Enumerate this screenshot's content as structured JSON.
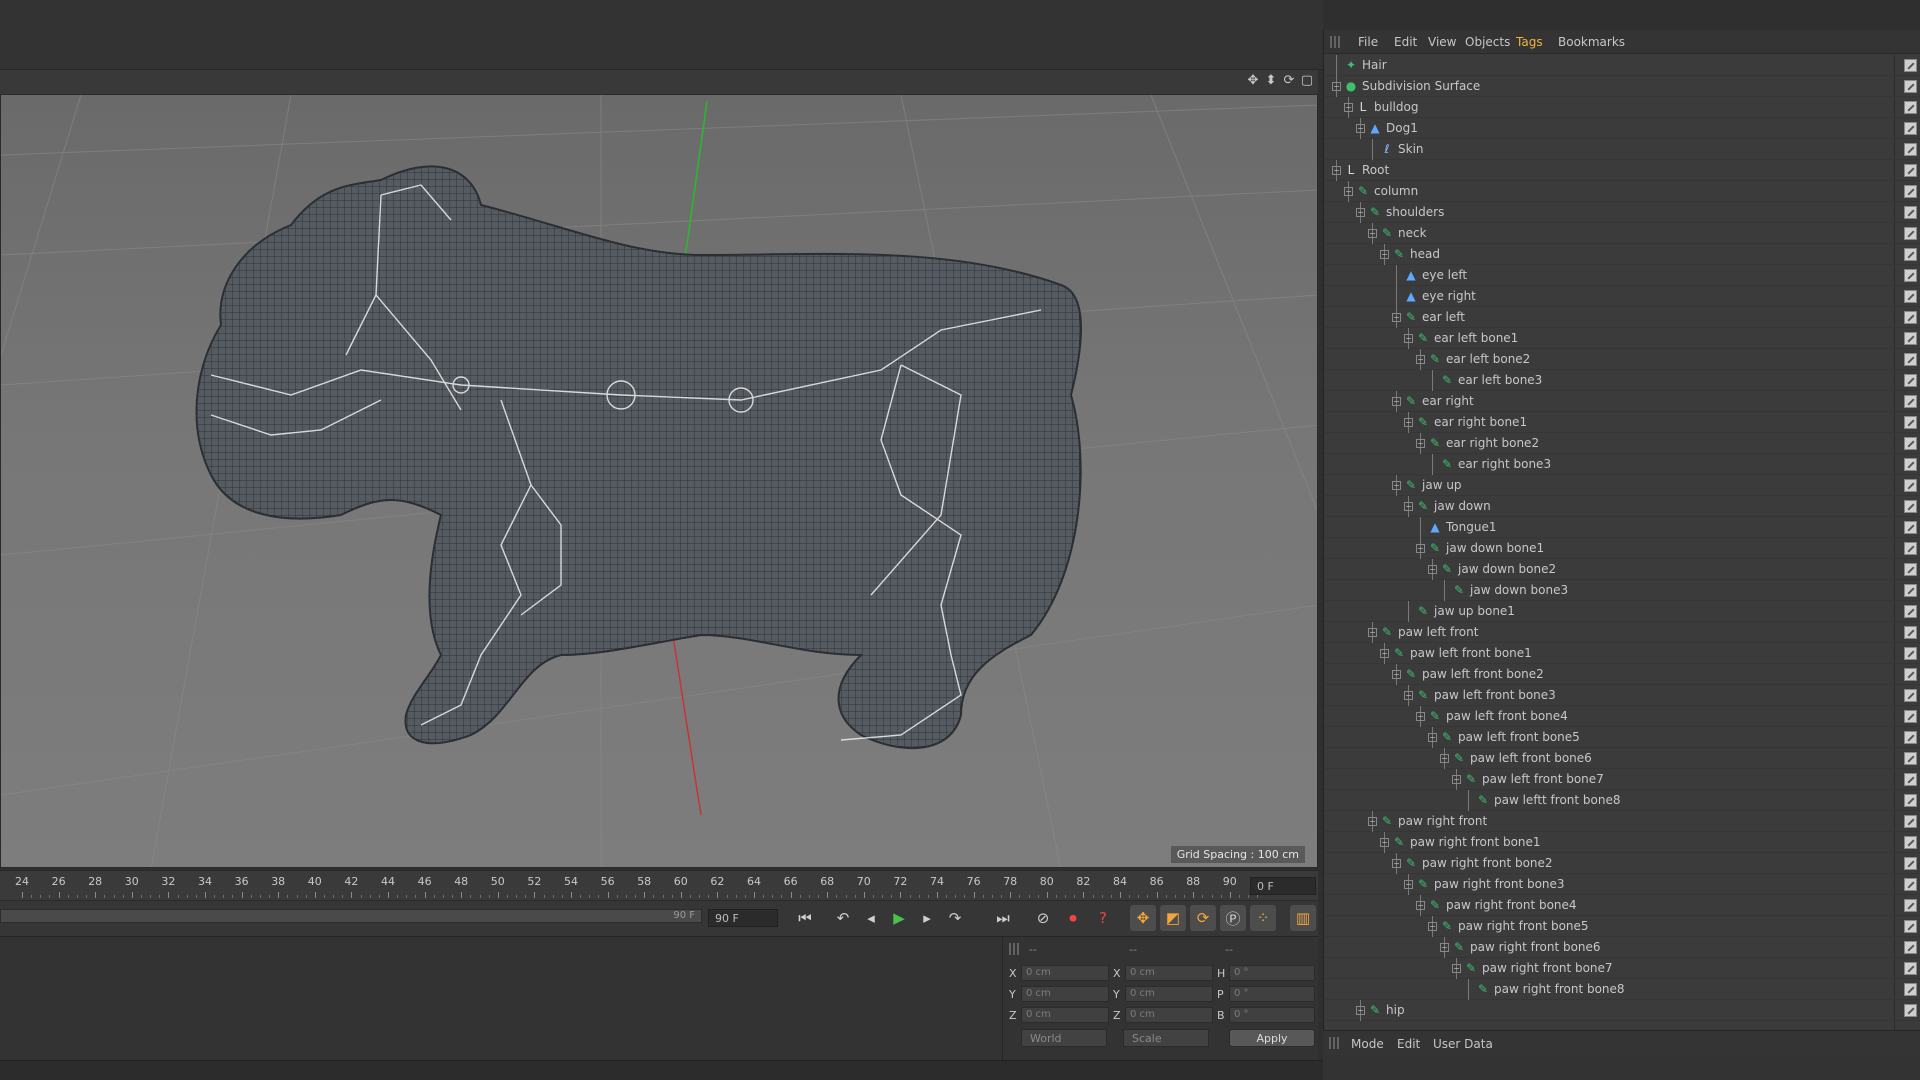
{
  "viewport": {
    "grid_spacing": "Grid Spacing : 100 cm",
    "icons": [
      "move-view-icon",
      "pan-view-icon",
      "rotate-view-icon",
      "maximize-view-icon"
    ]
  },
  "timeline": {
    "ticks": [
      "24",
      "26",
      "28",
      "30",
      "32",
      "34",
      "36",
      "38",
      "40",
      "42",
      "44",
      "46",
      "48",
      "50",
      "52",
      "54",
      "56",
      "58",
      "60",
      "62",
      "64",
      "66",
      "68",
      "70",
      "72",
      "74",
      "76",
      "78",
      "80",
      "82",
      "84",
      "86",
      "88",
      "90"
    ],
    "current_frame": "0 F",
    "range_end_label": "90 F",
    "range_end_field": "90 F"
  },
  "transport": {
    "buttons": [
      "go-to-start",
      "previous-key",
      "previous-frame",
      "play",
      "next-frame",
      "next-key",
      "go-to-end"
    ]
  },
  "coordinates": {
    "headers": [
      "--",
      "--",
      "--"
    ],
    "rows": [
      {
        "a": "X",
        "a_val": "0 cm",
        "b": "X",
        "b_val": "0 cm",
        "c": "H",
        "c_val": "0 °"
      },
      {
        "a": "Y",
        "a_val": "0 cm",
        "b": "Y",
        "b_val": "0 cm",
        "c": "P",
        "c_val": "0 °"
      },
      {
        "a": "Z",
        "a_val": "0 cm",
        "b": "Z",
        "b_val": "0 cm",
        "c": "B",
        "c_val": "0 °"
      }
    ],
    "space_dropdown": "World",
    "mode_dropdown": "Scale",
    "apply_label": "Apply"
  },
  "object_manager": {
    "menu": [
      "File",
      "Edit",
      "View",
      "Objects",
      "Tags",
      "Bookmarks"
    ],
    "active_menu": "Tags",
    "attr_menu": [
      "Mode",
      "Edit",
      "User Data"
    ],
    "rows": [
      {
        "label": "Hair",
        "depth": 0,
        "icon": "hair",
        "exp": false
      },
      {
        "label": "Subdivision Surface",
        "depth": 0,
        "icon": "subdiv",
        "exp": true
      },
      {
        "label": "bulldog",
        "depth": 1,
        "icon": "null",
        "exp": true
      },
      {
        "label": "Dog1",
        "depth": 2,
        "icon": "poly",
        "exp": true
      },
      {
        "label": "Skin",
        "depth": 3,
        "icon": "skin",
        "exp": false
      },
      {
        "label": "Root",
        "depth": 0,
        "icon": "null",
        "exp": true
      },
      {
        "label": "column",
        "depth": 1,
        "icon": "joint",
        "exp": true
      },
      {
        "label": "shoulders",
        "depth": 2,
        "icon": "joint",
        "exp": true
      },
      {
        "label": "neck",
        "depth": 3,
        "icon": "joint",
        "exp": true
      },
      {
        "label": "head",
        "depth": 4,
        "icon": "joint",
        "exp": true
      },
      {
        "label": "eye left",
        "depth": 5,
        "icon": "poly",
        "exp": false
      },
      {
        "label": "eye right",
        "depth": 5,
        "icon": "poly",
        "exp": false
      },
      {
        "label": "ear left",
        "depth": 5,
        "icon": "joint",
        "exp": true
      },
      {
        "label": "ear left bone1",
        "depth": 6,
        "icon": "joint",
        "exp": true
      },
      {
        "label": "ear left bone2",
        "depth": 7,
        "icon": "joint",
        "exp": true
      },
      {
        "label": "ear left bone3",
        "depth": 8,
        "icon": "joint",
        "exp": false
      },
      {
        "label": "ear right",
        "depth": 5,
        "icon": "joint",
        "exp": true
      },
      {
        "label": "ear right bone1",
        "depth": 6,
        "icon": "joint",
        "exp": true
      },
      {
        "label": "ear right bone2",
        "depth": 7,
        "icon": "joint",
        "exp": true
      },
      {
        "label": "ear right bone3",
        "depth": 8,
        "icon": "joint",
        "exp": false
      },
      {
        "label": "jaw up",
        "depth": 5,
        "icon": "joint",
        "exp": true
      },
      {
        "label": "jaw down",
        "depth": 6,
        "icon": "joint",
        "exp": true
      },
      {
        "label": "Tongue1",
        "depth": 7,
        "icon": "poly",
        "exp": false
      },
      {
        "label": "jaw down bone1",
        "depth": 7,
        "icon": "joint",
        "exp": true
      },
      {
        "label": "jaw down bone2",
        "depth": 8,
        "icon": "joint",
        "exp": true
      },
      {
        "label": "jaw down bone3",
        "depth": 9,
        "icon": "joint",
        "exp": false
      },
      {
        "label": "jaw up bone1",
        "depth": 6,
        "icon": "joint",
        "exp": false
      },
      {
        "label": "paw left front",
        "depth": 3,
        "icon": "joint",
        "exp": true
      },
      {
        "label": "paw left front  bone1",
        "depth": 4,
        "icon": "joint",
        "exp": true
      },
      {
        "label": "paw left front  bone2",
        "depth": 5,
        "icon": "joint",
        "exp": true
      },
      {
        "label": "paw left front  bone3",
        "depth": 6,
        "icon": "joint",
        "exp": true
      },
      {
        "label": "paw left front  bone4",
        "depth": 7,
        "icon": "joint",
        "exp": true
      },
      {
        "label": "paw left front  bone5",
        "depth": 8,
        "icon": "joint",
        "exp": true
      },
      {
        "label": "paw left front  bone6",
        "depth": 9,
        "icon": "joint",
        "exp": true
      },
      {
        "label": "paw left front  bone7",
        "depth": 10,
        "icon": "joint",
        "exp": true
      },
      {
        "label": "paw leftt front  bone8",
        "depth": 11,
        "icon": "joint",
        "exp": false
      },
      {
        "label": "paw right front",
        "depth": 3,
        "icon": "joint",
        "exp": true
      },
      {
        "label": "paw right front  bone1",
        "depth": 4,
        "icon": "joint",
        "exp": true
      },
      {
        "label": "paw right front  bone2",
        "depth": 5,
        "icon": "joint",
        "exp": true
      },
      {
        "label": "paw right front  bone3",
        "depth": 6,
        "icon": "joint",
        "exp": true
      },
      {
        "label": "paw right front  bone4",
        "depth": 7,
        "icon": "joint",
        "exp": true
      },
      {
        "label": "paw right front  bone5",
        "depth": 8,
        "icon": "joint",
        "exp": true
      },
      {
        "label": "paw right front  bone6",
        "depth": 9,
        "icon": "joint",
        "exp": true
      },
      {
        "label": "paw right front  bone7",
        "depth": 10,
        "icon": "joint",
        "exp": true
      },
      {
        "label": "paw right front  bone8",
        "depth": 11,
        "icon": "joint",
        "exp": false
      },
      {
        "label": "hip",
        "depth": 2,
        "icon": "joint",
        "exp": true
      }
    ]
  },
  "colors": {
    "accent": "#f2b33d",
    "joint_icon": "#3fbf6b",
    "poly_icon": "#5ea8ff",
    "play": "#49c249",
    "record": "#e44444"
  }
}
